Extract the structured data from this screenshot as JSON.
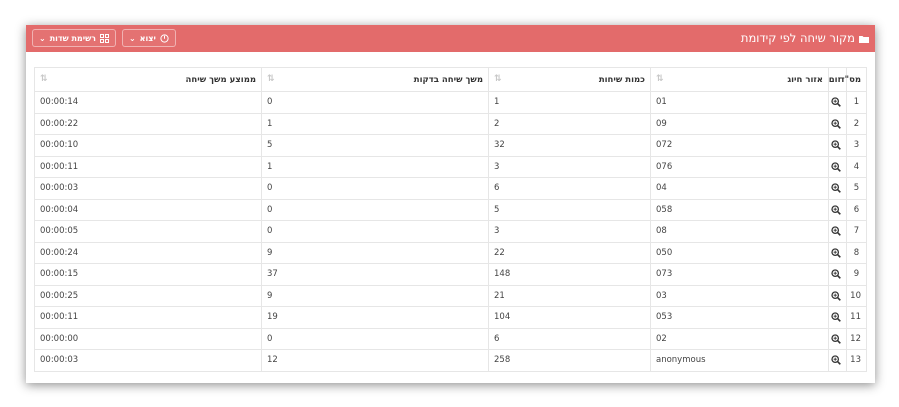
{
  "header": {
    "title": "מקור שיחה לפי קידומת",
    "export_label": "יצוא",
    "fields_label": "רשימת שדות",
    "color": "#e36b6b"
  },
  "table": {
    "columns": {
      "num": "מס\"ד",
      "zoom": "זום",
      "area": "אזור חיוג",
      "calls": "כמות שיחות",
      "duration": "משך שיחה בדקות",
      "avg": "ממוצע משך שיחה"
    },
    "rows": [
      {
        "num": "1",
        "area": "01",
        "calls": "1",
        "duration": "0",
        "avg": "00:00:14"
      },
      {
        "num": "2",
        "area": "09",
        "calls": "2",
        "duration": "1",
        "avg": "00:00:22"
      },
      {
        "num": "3",
        "area": "072",
        "calls": "32",
        "duration": "5",
        "avg": "00:00:10"
      },
      {
        "num": "4",
        "area": "076",
        "calls": "3",
        "duration": "1",
        "avg": "00:00:11"
      },
      {
        "num": "5",
        "area": "04",
        "calls": "6",
        "duration": "0",
        "avg": "00:00:03"
      },
      {
        "num": "6",
        "area": "058",
        "calls": "5",
        "duration": "0",
        "avg": "00:00:04"
      },
      {
        "num": "7",
        "area": "08",
        "calls": "3",
        "duration": "0",
        "avg": "00:00:05"
      },
      {
        "num": "8",
        "area": "050",
        "calls": "22",
        "duration": "9",
        "avg": "00:00:24"
      },
      {
        "num": "9",
        "area": "073",
        "calls": "148",
        "duration": "37",
        "avg": "00:00:15"
      },
      {
        "num": "10",
        "area": "03",
        "calls": "21",
        "duration": "9",
        "avg": "00:00:25"
      },
      {
        "num": "11",
        "area": "053",
        "calls": "104",
        "duration": "19",
        "avg": "00:00:11"
      },
      {
        "num": "12",
        "area": "02",
        "calls": "6",
        "duration": "0",
        "avg": "00:00:00"
      },
      {
        "num": "13",
        "area": "anonymous",
        "calls": "258",
        "duration": "12",
        "avg": "00:00:03"
      }
    ]
  },
  "icons": {
    "title": "folder-icon",
    "export": "power-icon",
    "fields": "grid-icon",
    "zoom": "search-plus-icon",
    "sort": "sort-icon"
  }
}
